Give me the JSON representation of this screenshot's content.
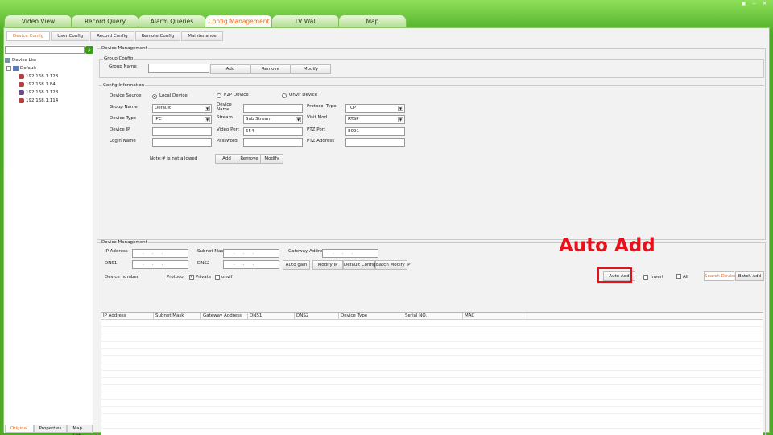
{
  "window": {
    "controls": [
      "▣",
      "−",
      "✕"
    ]
  },
  "main_tabs": [
    "Video View",
    "Record Query",
    "Alarm Queries",
    "Config Management",
    "TV Wall",
    "Map"
  ],
  "sub_tabs": [
    "Device Config",
    "User Config",
    "Record Config",
    "Remote Config",
    "Maintenance"
  ],
  "left_panel": {
    "search_icon": "search-icon",
    "tree": {
      "root": "Device List",
      "group": "Default",
      "devices": [
        "192.168.1.123",
        "192.168.1.84",
        "192.168.1.128",
        "192.168.1.114"
      ]
    },
    "bottom_tabs": [
      "Original",
      "Properties",
      "Map List"
    ]
  },
  "device_management_top": {
    "title": "Device Management",
    "group_config": {
      "title": "Group Config",
      "group_name_label": "Group Name",
      "group_name_value": "",
      "buttons": [
        "Add",
        "Remove",
        "Modify"
      ]
    },
    "config_information": {
      "title": "Config Information",
      "device_source_label": "Device Source",
      "sources": [
        "Local Device",
        "P2P Device",
        "Onvif Device"
      ],
      "group_name_label": "Group Name",
      "group_name_value": "Default",
      "device_name_label": "Device Name",
      "device_name_value": "",
      "protocol_type_label": "Protocol Type",
      "protocol_type_value": "TCP",
      "device_type_label": "Device Type",
      "device_type_value": "IPC",
      "stream_label": "Stream",
      "stream_value": "Sub Stream",
      "visit_mod_label": "Visit Mod",
      "visit_mod_value": "RTSP",
      "device_ip_label": "Device IP",
      "device_ip_value": "",
      "video_port_label": "Video Port",
      "video_port_value": "554",
      "ptz_port_label": "PTZ Port",
      "ptz_port_value": "8091",
      "login_name_label": "Login Name",
      "login_name_value": "",
      "password_label": "Password",
      "password_value": "",
      "ptz_address_label": "PTZ Address",
      "ptz_address_value": "",
      "note": "Note:# is not allowed",
      "buttons": [
        "Add",
        "Remove",
        "Modify"
      ]
    }
  },
  "device_management_bottom": {
    "title": "Device Management",
    "ip_address_label": "IP Address",
    "subnet_mask_label": "Subnet Mask",
    "gateway_label": "Gateway Address",
    "dns1_label": "DNS1",
    "dns2_label": "DNS2",
    "ip_placeholder": "...",
    "buttons": [
      "Auto gain",
      "Modify IP",
      "Default Config",
      "Batch Modify IP"
    ],
    "device_number_label": "Device number",
    "protocol_label": "Protocol",
    "private_label": "Private",
    "onvif_label": "onvif",
    "auto_add_label": "Auto Add",
    "invert_label": "Invert",
    "all_label": "All",
    "search_device_label": "Search Device",
    "batch_add_label": "Batch Add",
    "columns": [
      "IP Address",
      "Subnet Mask",
      "Gateway Address",
      "DNS1",
      "DNS2",
      "Device Type",
      "Serial NO.",
      "MAC"
    ]
  },
  "annotation": {
    "text": "Auto Add",
    "color": "#e8101a"
  },
  "colors": {
    "accent": "#ec6b1a",
    "frame_green": "#4ea926"
  }
}
